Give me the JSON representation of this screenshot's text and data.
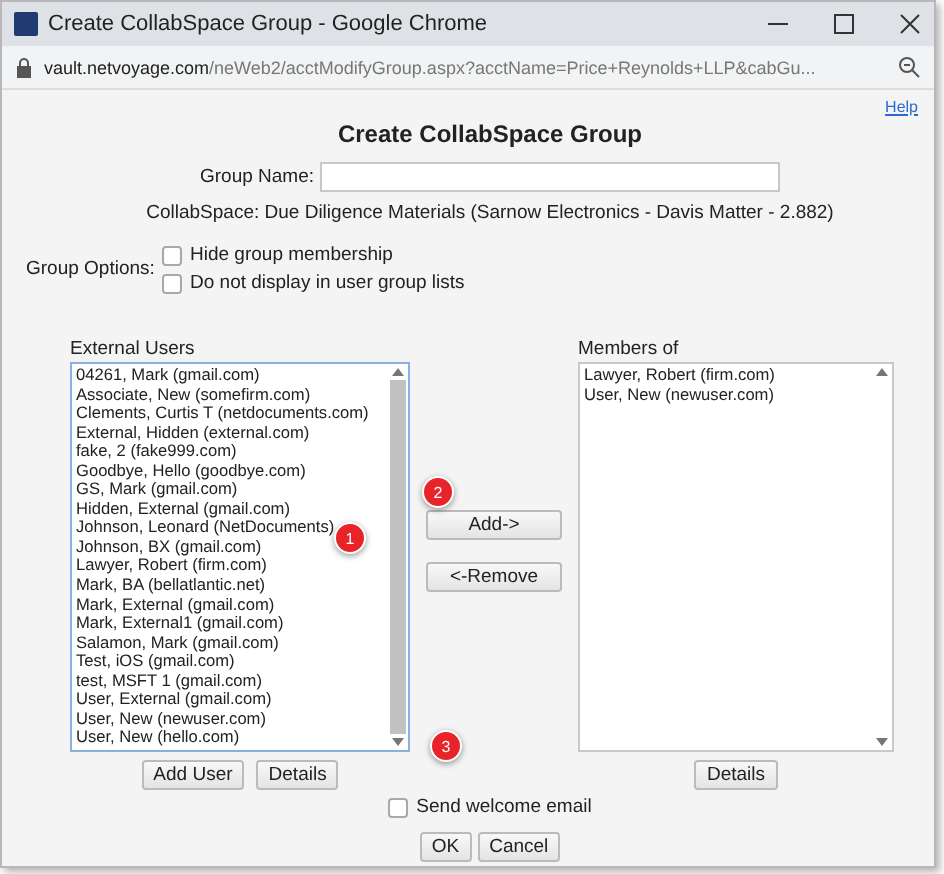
{
  "window": {
    "title": "Create CollabSpace Group - Google Chrome",
    "url_host": "vault.netvoyage.com",
    "url_path": "/neWeb2/acctModifyGroup.aspx?acctName=Price+Reynolds+LLP&cabGu..."
  },
  "help_link": "Help",
  "heading": "Create CollabSpace Group",
  "group_name": {
    "label": "Group Name:"
  },
  "collabspace": "CollabSpace: Due Diligence Materials (Sarnow Electronics - Davis Matter - 2.882)",
  "group_options": {
    "label": "Group Options:",
    "options": [
      {
        "label": "Hide group membership",
        "checked": false
      },
      {
        "label": "Do not display in user group lists",
        "checked": false
      }
    ]
  },
  "external_users": {
    "label": "External Users",
    "items": [
      "04261, Mark (gmail.com)",
      "Associate, New (somefirm.com)",
      "Clements, Curtis T (netdocuments.com)",
      "External, Hidden (external.com)",
      "fake, 2 (fake999.com)",
      "Goodbye, Hello (goodbye.com)",
      "GS, Mark (gmail.com)",
      "Hidden, External (gmail.com)",
      "Johnson, Leonard (NetDocuments)",
      "Johnson, BX (gmail.com)",
      "Lawyer, Robert (firm.com)",
      "Mark, BA (bellatlantic.net)",
      "Mark, External (gmail.com)",
      "Mark, External1 (gmail.com)",
      "Salamon, Mark (gmail.com)",
      "Test, iOS (gmail.com)",
      "test, MSFT 1 (gmail.com)",
      "User, External (gmail.com)",
      "User, New (newuser.com)",
      "User, New (hello.com)"
    ],
    "buttons": [
      "Add User",
      "Details"
    ]
  },
  "move_buttons": [
    "Add->",
    "<-Remove"
  ],
  "members": {
    "label": "Members of",
    "items": [
      "Lawyer, Robert (firm.com)",
      "User, New (newuser.com)"
    ],
    "buttons": [
      "Details"
    ]
  },
  "welcome_email": {
    "label": "Send welcome email",
    "checked": false
  },
  "dialog_buttons": [
    "OK",
    "Cancel"
  ],
  "callouts": [
    "1",
    "2",
    "3"
  ]
}
